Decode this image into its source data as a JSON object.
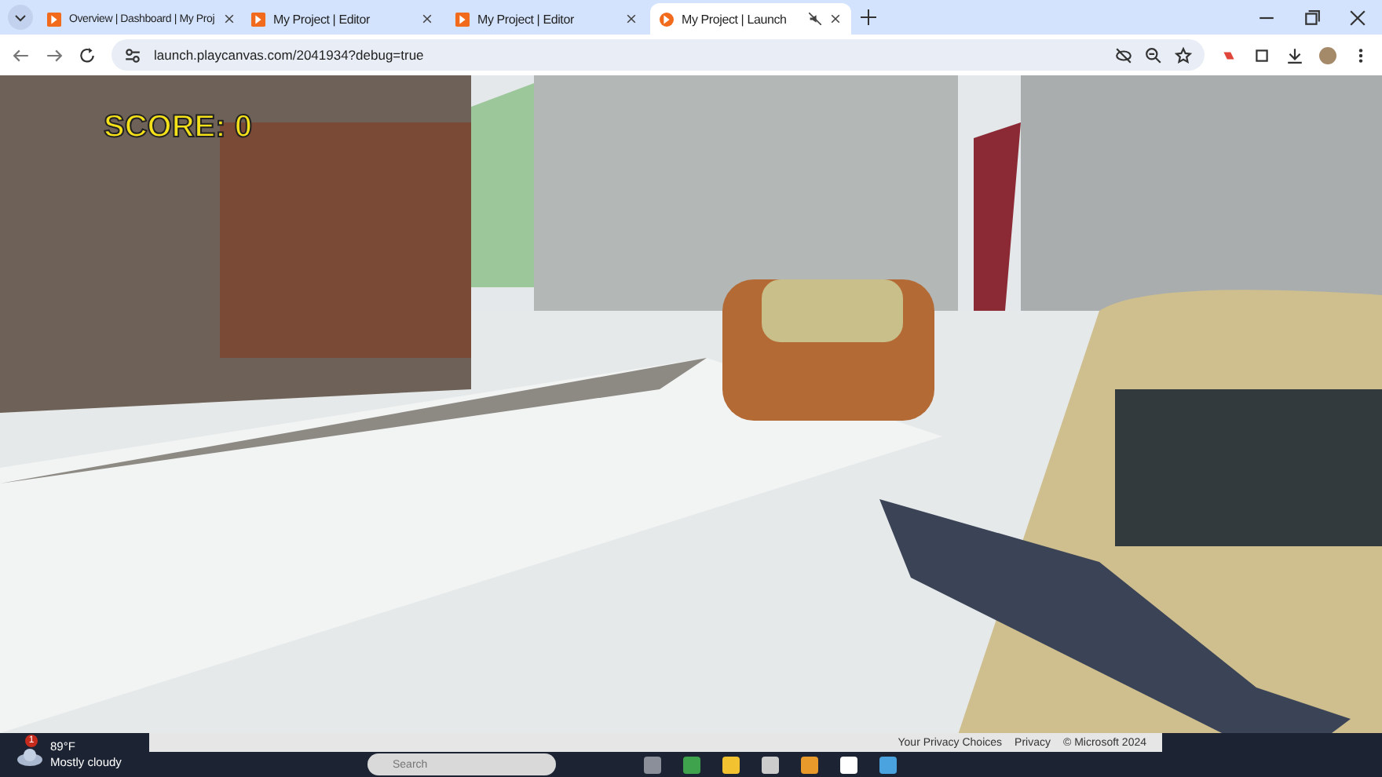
{
  "tabs": [
    {
      "title": "Overview | Dashboard | My Proj",
      "selected": false,
      "muted": false
    },
    {
      "title": "My Project | Editor",
      "selected": false,
      "muted": false
    },
    {
      "title": "My Project | Editor",
      "selected": false,
      "muted": false
    },
    {
      "title": "My Project | Launch",
      "selected": true,
      "muted": true
    }
  ],
  "address_bar": {
    "url": "launch.playcanvas.com/2041934?debug=true"
  },
  "game": {
    "score": "SCORE: 0"
  },
  "taskbar": {
    "weather": {
      "badge": "1",
      "temperature": "89°F",
      "condition": "Mostly cloudy"
    },
    "search": {
      "placeholder": "Search"
    },
    "privacy_links": [
      "Your Privacy Choices",
      "Privacy",
      "© Microsoft 2024"
    ]
  }
}
